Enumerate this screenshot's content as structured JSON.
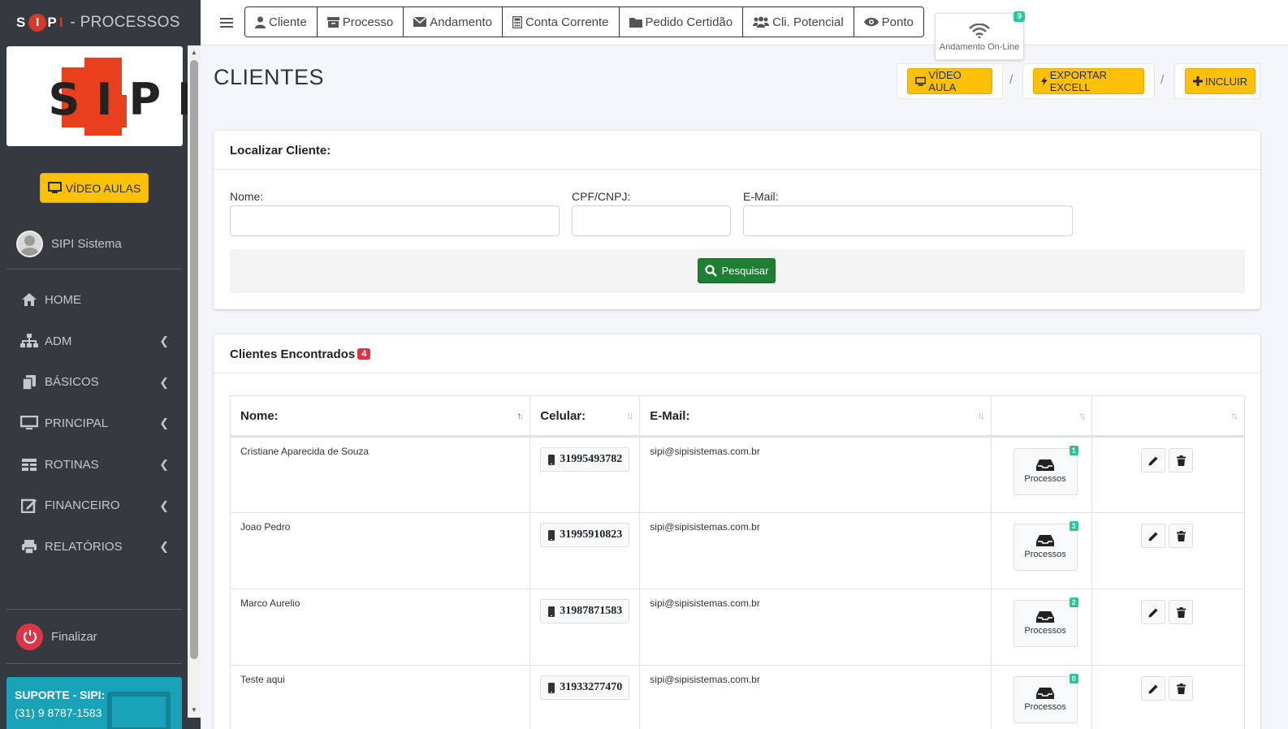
{
  "brand": {
    "logo_text_left": "S",
    "logo_text_mid": "I",
    "logo_text_p": "P",
    "logo_text_right": "I",
    "suffix": "- PROCESSOS"
  },
  "sidebar": {
    "video_aulas_label": "VÍDEO AULAS",
    "user_name": "SIPI Sistema",
    "items": [
      {
        "label": "HOME",
        "icon": "home-icon",
        "has_children": false
      },
      {
        "label": "ADM",
        "icon": "sitemap-icon",
        "has_children": true
      },
      {
        "label": "BÁSICOS",
        "icon": "copy-icon",
        "has_children": true
      },
      {
        "label": "PRINCIPAL",
        "icon": "desktop-icon",
        "has_children": true
      },
      {
        "label": "ROTINAS",
        "icon": "table-icon",
        "has_children": true
      },
      {
        "label": "FINANCEIRO",
        "icon": "edit-icon",
        "has_children": true
      },
      {
        "label": "RELATÓRIOS",
        "icon": "print-icon",
        "has_children": true
      }
    ],
    "finalizar_label": "Finalizar",
    "suporte_title": "SUPORTE - SIPI:",
    "suporte_phone": "(31) 9 8787-1583"
  },
  "topnav": {
    "buttons": [
      {
        "label": "Cliente",
        "icon": "user-icon"
      },
      {
        "label": "Processo",
        "icon": "archive-icon"
      },
      {
        "label": "Andamento",
        "icon": "envelope-icon"
      },
      {
        "label": "Conta Corrente",
        "icon": "calculator-icon"
      },
      {
        "label": "Pedido Certidão",
        "icon": "folder-icon"
      },
      {
        "label": "Cli. Potencial",
        "icon": "users-icon"
      },
      {
        "label": "Ponto",
        "icon": "eye-icon"
      }
    ],
    "online_label": "Andamento On-Line",
    "online_count": "9"
  },
  "page": {
    "title": "CLIENTES",
    "video_aula_label": "VÍDEO AULA",
    "exportar_label": "EXPORTAR EXCELL",
    "incluir_label": "INCLUIR",
    "separator": "/"
  },
  "search": {
    "header": "Localizar Cliente:",
    "nome_label": "Nome:",
    "nome_value": "",
    "cpf_label": "CPF/CNPJ:",
    "cpf_value": "",
    "email_label": "E-Mail:",
    "email_value": "",
    "button_label": "Pesquisar"
  },
  "results": {
    "header": "Clientes Encontrados",
    "count": "4",
    "columns": [
      "Nome:",
      "Celular:",
      "E-Mail:",
      "",
      ""
    ],
    "processos_label": "Processos",
    "rows": [
      {
        "nome": "Cristiane Aparecida de Souza",
        "celular": "31995493782",
        "email": "sipi@sipisistemas.com.br",
        "processos": "1"
      },
      {
        "nome": "Joao Pedro",
        "celular": "31995910823",
        "email": "sipi@sipisistemas.com.br",
        "processos": "3"
      },
      {
        "nome": "Marco Aurelio",
        "celular": "31987871583",
        "email": "sipi@sipisistemas.com.br",
        "processos": "2"
      },
      {
        "nome": "Teste aqui",
        "celular": "31933277470",
        "email": "sipi@sipisistemas.com.br",
        "processos": "0"
      }
    ]
  },
  "colors": {
    "sidebar": "#343a40",
    "warning": "#ffc107",
    "success": "#1e7e34",
    "danger": "#dc3545",
    "teal": "#20c997",
    "info": "#17a2b8"
  }
}
